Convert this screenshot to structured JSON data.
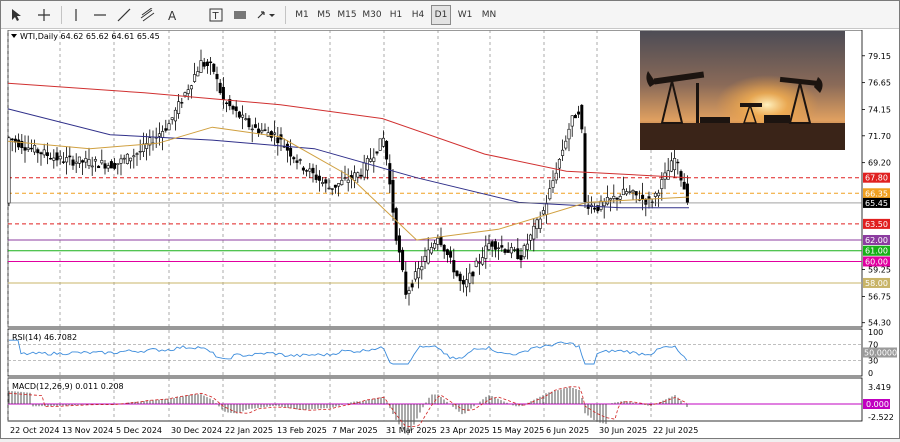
{
  "toolbar": {
    "timeframes": [
      "M1",
      "M5",
      "M15",
      "M30",
      "H1",
      "H4",
      "D1",
      "W1",
      "MN"
    ],
    "active_timeframe": "D1"
  },
  "chart": {
    "title": "WTI,Daily  64.62 65.62 64.61 65.45",
    "price_ticks": [
      "79.15",
      "76.65",
      "74.15",
      "71.70",
      "69.20",
      "59.25",
      "56.75",
      "54.30"
    ],
    "level_labels": [
      {
        "text": "67.80",
        "color": "#e02020",
        "dashed": true,
        "value": 67.8
      },
      {
        "text": "66.35",
        "color": "#f0a020",
        "dashed": true,
        "value": 66.35
      },
      {
        "text": "65.45",
        "color": "#000000",
        "dashed": false,
        "value": 65.45
      },
      {
        "text": "63.50",
        "color": "#e02020",
        "dashed": true,
        "value": 63.5
      },
      {
        "text": "62.00",
        "color": "#8c3ca0",
        "dashed": false,
        "value": 62.0
      },
      {
        "text": "61.00",
        "color": "#18b018",
        "dashed": false,
        "value": 61.0
      },
      {
        "text": "60.00",
        "color": "#e000a0",
        "dashed": false,
        "value": 60.0
      },
      {
        "text": "58.00",
        "color": "#c8b468",
        "dashed": false,
        "value": 58.0
      }
    ],
    "date_ticks": [
      "22 Oct 2024",
      "13 Nov 2024",
      "5 Dec 2024",
      "30 Dec 2024",
      "22 Jan 2025",
      "13 Feb 2025",
      "7 Mar 2025",
      "31 Mar 2025",
      "23 Apr 2025",
      "15 May 2025",
      "6 Jun 2025",
      "30 Jun 2025",
      "22 Jul 2025"
    ]
  },
  "rsi": {
    "label": "RSI(14) 46.7082",
    "ticks": [
      "100",
      "70",
      "30",
      "0"
    ],
    "current_label": "50.0000"
  },
  "macd": {
    "label": "MACD(12,26,9) 0.011 0.208",
    "ticks": [
      "3.419",
      "-2.522"
    ],
    "current_label": "0.000"
  },
  "chart_data": {
    "type": "candlestick",
    "symbol": "WTI",
    "timeframe": "Daily",
    "close_profile": [
      [
        "22 Oct 2024",
        71.5
      ],
      [
        "5 Nov 2024",
        70.5
      ],
      [
        "13 Nov 2024",
        69.5
      ],
      [
        "5 Dec 2024",
        69.0
      ],
      [
        "15 Dec 2024",
        70.3
      ],
      [
        "30 Dec 2024",
        72.8
      ],
      [
        "8 Jan 2025",
        78.5
      ],
      [
        "15 Jan 2025",
        78.0
      ],
      [
        "22 Jan 2025",
        75.0
      ],
      [
        "1 Feb 2025",
        72.5
      ],
      [
        "13 Feb 2025",
        71.8
      ],
      [
        "25 Feb 2025",
        69.0
      ],
      [
        "7 Mar 2025",
        66.8
      ],
      [
        "20 Mar 2025",
        68.3
      ],
      [
        "31 Mar 2025",
        71.5
      ],
      [
        "7 Apr 2025",
        62.5
      ],
      [
        "10 Apr 2025",
        57.0
      ],
      [
        "23 Apr 2025",
        62.5
      ],
      [
        "5 May 2025",
        57.5
      ],
      [
        "15 May 2025",
        61.8
      ],
      [
        "27 May 2025",
        60.5
      ],
      [
        "6 Jun 2025",
        64.8
      ],
      [
        "13 Jun 2025",
        73.0
      ],
      [
        "23 Jun 2025",
        74.5
      ],
      [
        "24 Jun 2025",
        65.5
      ],
      [
        "30 Jun 2025",
        65.0
      ],
      [
        "10 Jul 2025",
        66.5
      ],
      [
        "22 Jul 2025",
        65.5
      ],
      [
        "30 Jul 2025",
        69.6
      ],
      [
        "4 Aug 2025",
        65.45
      ]
    ],
    "moving_averages": [
      {
        "color": "#d03030",
        "values": [
          [
            0,
            76.6
          ],
          [
            0.2,
            75.7
          ],
          [
            0.4,
            74.6
          ],
          [
            0.55,
            73.3
          ],
          [
            0.7,
            70.0
          ],
          [
            0.82,
            68.4
          ],
          [
            1.0,
            67.8
          ]
        ]
      },
      {
        "color": "#30308a",
        "values": [
          [
            0,
            74.2
          ],
          [
            0.15,
            71.8
          ],
          [
            0.3,
            71.3
          ],
          [
            0.45,
            70.5
          ],
          [
            0.6,
            67.8
          ],
          [
            0.75,
            65.5
          ],
          [
            0.9,
            65.0
          ],
          [
            1.0,
            65.0
          ]
        ]
      },
      {
        "color": "#d0a040",
        "values": [
          [
            0,
            71.2
          ],
          [
            0.12,
            70.5
          ],
          [
            0.22,
            71.0
          ],
          [
            0.3,
            72.5
          ],
          [
            0.4,
            71.6
          ],
          [
            0.5,
            68.0
          ],
          [
            0.6,
            62.0
          ],
          [
            0.72,
            63.0
          ],
          [
            0.85,
            65.5
          ],
          [
            1.0,
            66.0
          ]
        ]
      }
    ]
  }
}
